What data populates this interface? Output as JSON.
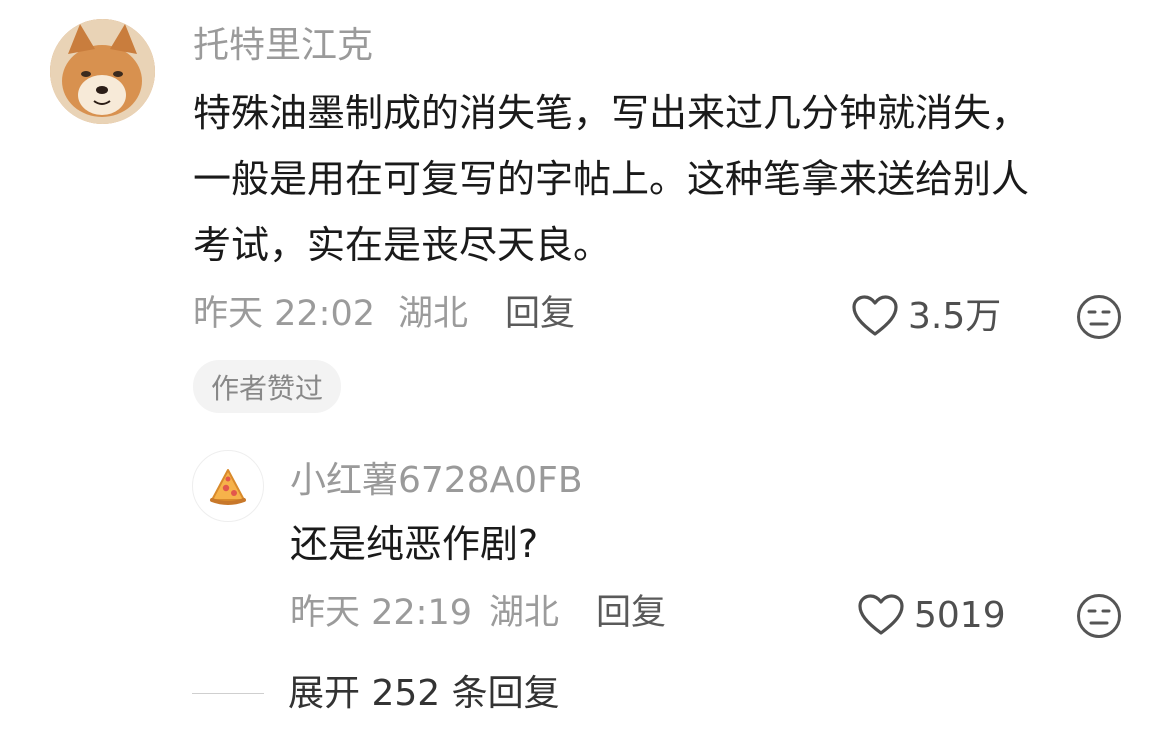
{
  "main_comment": {
    "username": "托特里江克",
    "content_lines": [
      "特殊油墨制成的消失笔，写出来过几分钟就消失，",
      "一般是用在可复写的字帖上。这种笔拿来送给别人",
      "考试，实在是丧尽天良。"
    ],
    "time": "昨天 22:02",
    "location": "湖北",
    "reply_label": "回复",
    "like_count": "3.5万",
    "badge": "作者赞过",
    "avatar_icon": "shiba-dog-avatar",
    "like_icon": "heart-outline-icon",
    "reaction_icon": "meh-face-icon"
  },
  "reply_comment": {
    "username": "小红薯6728A0FB",
    "content": "还是纯恶作剧?",
    "time": "昨天 22:19",
    "location": "湖北",
    "reply_label": "回复",
    "like_count": "5019",
    "avatar_icon": "pizza-slice-avatar",
    "like_icon": "heart-outline-icon",
    "reaction_icon": "meh-face-icon"
  },
  "expand": {
    "label": "展开 252 条回复"
  },
  "colors": {
    "text_primary": "#1a1a1a",
    "text_secondary": "#9b9b9b",
    "badge_bg": "#f3f3f3"
  }
}
